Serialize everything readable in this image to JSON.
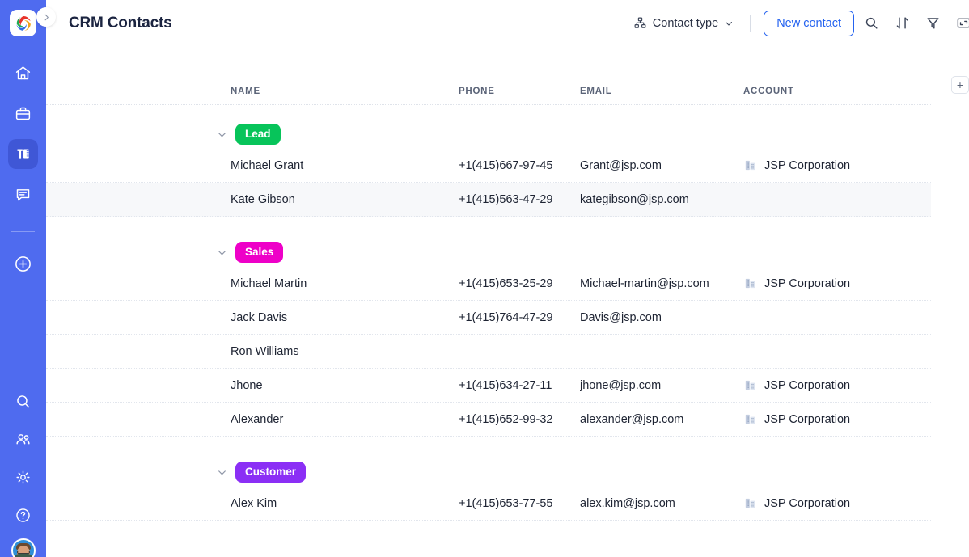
{
  "app": {
    "logo_icon": "app-logo-swirl",
    "collapse_icon": "chevron-right-icon"
  },
  "sidebar": {
    "top_items": [
      {
        "icon": "home-icon",
        "name": "home",
        "active": false
      },
      {
        "icon": "briefcase-icon",
        "name": "workspace",
        "active": false
      },
      {
        "icon": "tools-icon",
        "name": "tools",
        "active": true
      },
      {
        "icon": "chat-icon",
        "name": "chat",
        "active": false
      }
    ],
    "create_item": {
      "icon": "plus-circle-icon",
      "name": "create"
    },
    "bottom_items": [
      {
        "icon": "search-icon",
        "name": "search"
      },
      {
        "icon": "people-icon",
        "name": "contacts"
      },
      {
        "icon": "gear-icon",
        "name": "settings"
      },
      {
        "icon": "help-circle-icon",
        "name": "help"
      }
    ],
    "avatar": {
      "name": "user-avatar"
    }
  },
  "header": {
    "title": "CRM Contacts",
    "contact_type_label": "Contact type",
    "contact_type_icon": "hierarchy-icon",
    "chevron_icon": "chevron-down-icon",
    "new_contact_label": "New contact",
    "actions": [
      {
        "icon": "search-icon",
        "name": "search-button"
      },
      {
        "icon": "sort-icon",
        "name": "sort-button"
      },
      {
        "icon": "filter-icon",
        "name": "filter-button"
      },
      {
        "icon": "expand-icon",
        "name": "expand-button"
      },
      {
        "icon": "more-icon",
        "name": "more-button"
      }
    ]
  },
  "table": {
    "columns": [
      "NAME",
      "PHONE",
      "EMAIL",
      "ACCOUNT"
    ],
    "add_column_label": "+",
    "account_icon": "building-icon",
    "groups": [
      {
        "label": "Lead",
        "color": "#07c45a",
        "collapsed": false,
        "rows": [
          {
            "name": "Michael Grant",
            "phone": "+1(415)667-97-45",
            "email": "Grant@jsp.com",
            "account": "JSP Corporation",
            "shaded": false
          },
          {
            "name": "Kate Gibson",
            "phone": "+1(415)563-47-29",
            "email": "kategibson@jsp.com",
            "account": "",
            "shaded": true
          }
        ]
      },
      {
        "label": "Sales",
        "color": "#ee00c8",
        "collapsed": false,
        "rows": [
          {
            "name": "Michael Martin",
            "phone": "+1(415)653-25-29",
            "email": "Michael-martin@jsp.com",
            "account": "JSP Corporation",
            "shaded": false
          },
          {
            "name": "Jack Davis",
            "phone": "+1(415)764-47-29",
            "email": "Davis@jsp.com",
            "account": "",
            "shaded": false
          },
          {
            "name": "Ron Williams",
            "phone": "",
            "email": "",
            "account": "",
            "shaded": false
          },
          {
            "name": "Jhone",
            "phone": "+1(415)634-27-11",
            "email": "jhone@jsp.com",
            "account": "JSP Corporation",
            "shaded": false
          },
          {
            "name": "Alexander",
            "phone": "+1(415)652-99-32",
            "email": "alexander@jsp.com",
            "account": "JSP Corporation",
            "shaded": false
          }
        ]
      },
      {
        "label": "Customer",
        "color": "#8b2ff5",
        "collapsed": false,
        "rows": [
          {
            "name": "Alex Kim",
            "phone": "+1(415)653-77-55",
            "email": "alex.kim@jsp.com",
            "account": "JSP Corporation",
            "shaded": false
          }
        ]
      }
    ]
  }
}
